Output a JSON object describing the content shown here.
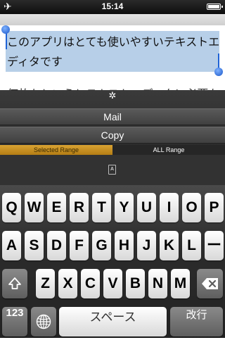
{
  "status_bar": {
    "time": "15:14"
  },
  "editor": {
    "selected_line1": "このアプリはとても使いやすいテキストエ",
    "selected_line2": "ディタです",
    "body_line": "何故かというとテキストエディタに必要な"
  },
  "popup": {
    "mail_label": "Mail",
    "copy_label": "Copy",
    "segment_left": "Selected Range",
    "segment_right": "ALL Range"
  },
  "keyboard": {
    "row1": [
      "Q",
      "W",
      "E",
      "R",
      "T",
      "Y",
      "U",
      "I",
      "O",
      "P"
    ],
    "row2": [
      "A",
      "S",
      "D",
      "F",
      "G",
      "H",
      "J",
      "K",
      "L",
      "ー"
    ],
    "row3": [
      "Z",
      "X",
      "C",
      "V",
      "B",
      "N",
      "M"
    ],
    "num_label": "123",
    "space_label": "スペース",
    "return_label": "改行"
  },
  "colors": {
    "selection": "#b7cfe8",
    "selection_handle": "#1e63d6",
    "segment_active": "#c8901f"
  }
}
